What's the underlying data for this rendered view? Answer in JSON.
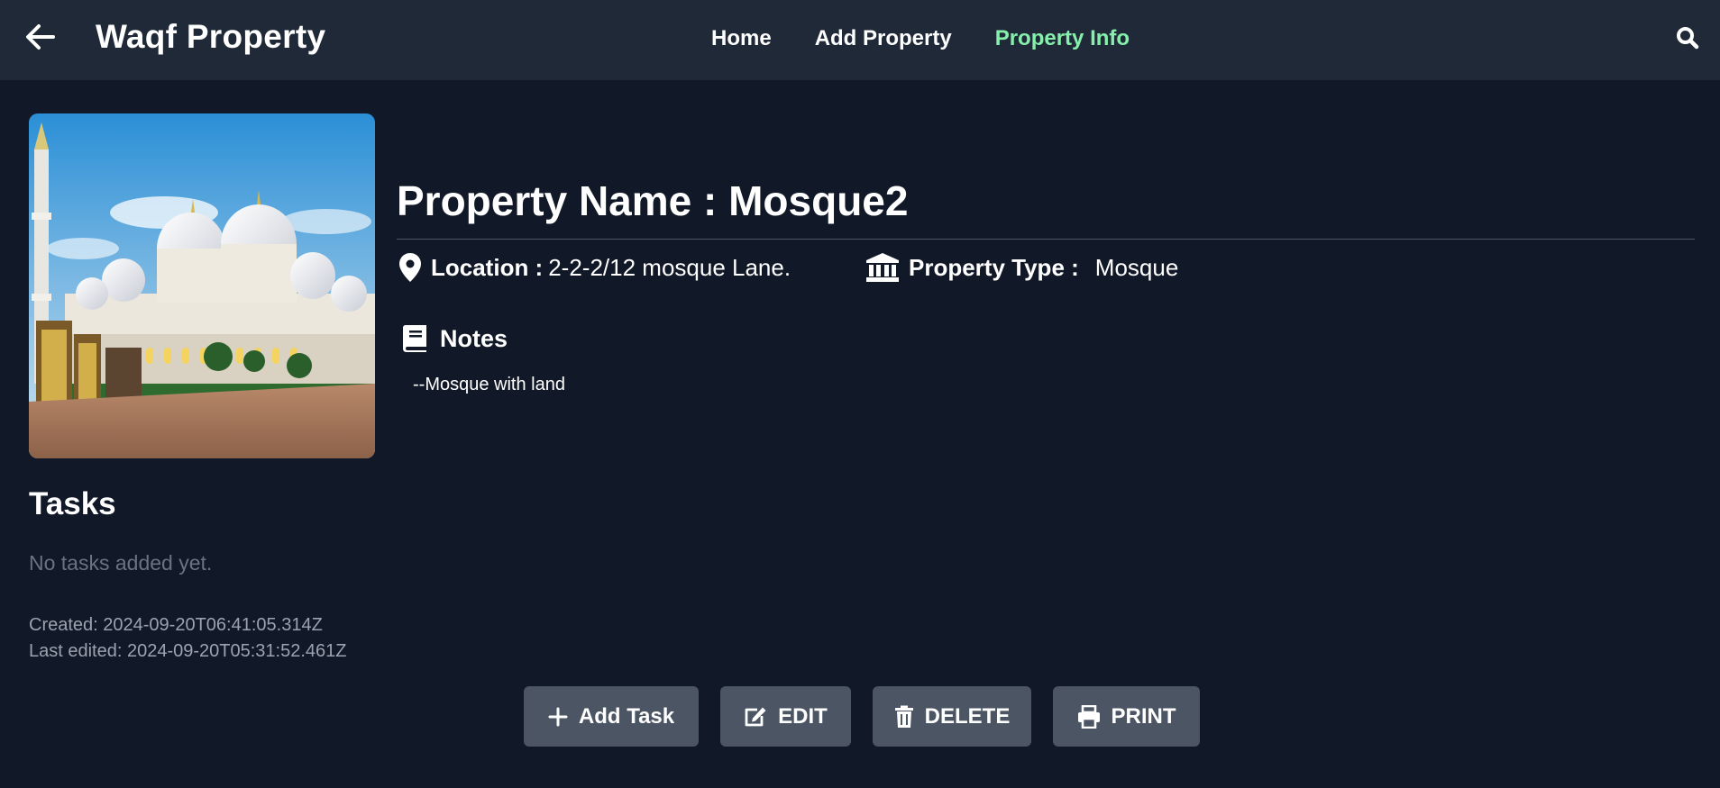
{
  "header": {
    "title": "Waqf Property",
    "nav": [
      {
        "label": "Home",
        "active": false
      },
      {
        "label": "Add Property",
        "active": false
      },
      {
        "label": "Property Info",
        "active": true
      }
    ],
    "back_icon": "arrow-left-icon",
    "search_icon": "search-icon"
  },
  "property": {
    "name_heading": "Property Name : Mosque2",
    "location_label": "Location :",
    "location_value": "2-2-2/12 mosque Lane.",
    "type_label": "Property Type :",
    "type_value": "Mosque",
    "notes_label": "Notes",
    "notes_text": "--Mosque with land"
  },
  "tasks": {
    "heading": "Tasks",
    "empty_text": "No tasks added yet."
  },
  "meta": {
    "created": "Created: 2024-09-20T06:41:05.314Z",
    "edited": "Last edited: 2024-09-20T05:31:52.461Z"
  },
  "actions": {
    "add_task": "Add Task",
    "edit": "EDIT",
    "delete": "DELETE",
    "print": "PRINT"
  },
  "colors": {
    "background": "#111827",
    "navbar": "#1f2937",
    "active_nav": "#86efac",
    "button": "#4b5563"
  }
}
